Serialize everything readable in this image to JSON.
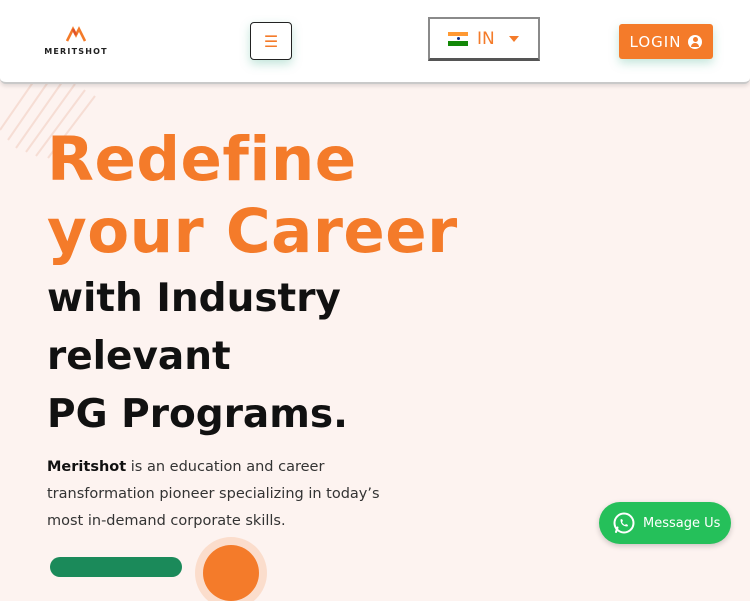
{
  "header": {
    "logo_text": "MERITSHOT",
    "menu_icon": "hamburger-icon",
    "country": {
      "code": "IN",
      "flag": "india-flag-icon",
      "flag_colors": [
        "#ff9933",
        "#ffffff",
        "#138808"
      ]
    },
    "login_label": "LOGIN",
    "login_icon": "user-circle-icon"
  },
  "hero": {
    "headline_orange": [
      "Redefine",
      "your Career"
    ],
    "headline_black": [
      "with Industry",
      "relevant",
      "PG Programs."
    ],
    "description_brand": "Meritshot",
    "description_lines": [
      " is an education and career",
      "transformation pioneer specializing in today’s",
      "most in-demand corporate skills."
    ]
  },
  "chat": {
    "label": "Message Us",
    "icon": "whatsapp-icon"
  },
  "colors": {
    "accent": "#f47b2a",
    "background": "#fdf3f0",
    "whatsapp": "#25c05a",
    "cta_green": "#1b8a5a"
  }
}
